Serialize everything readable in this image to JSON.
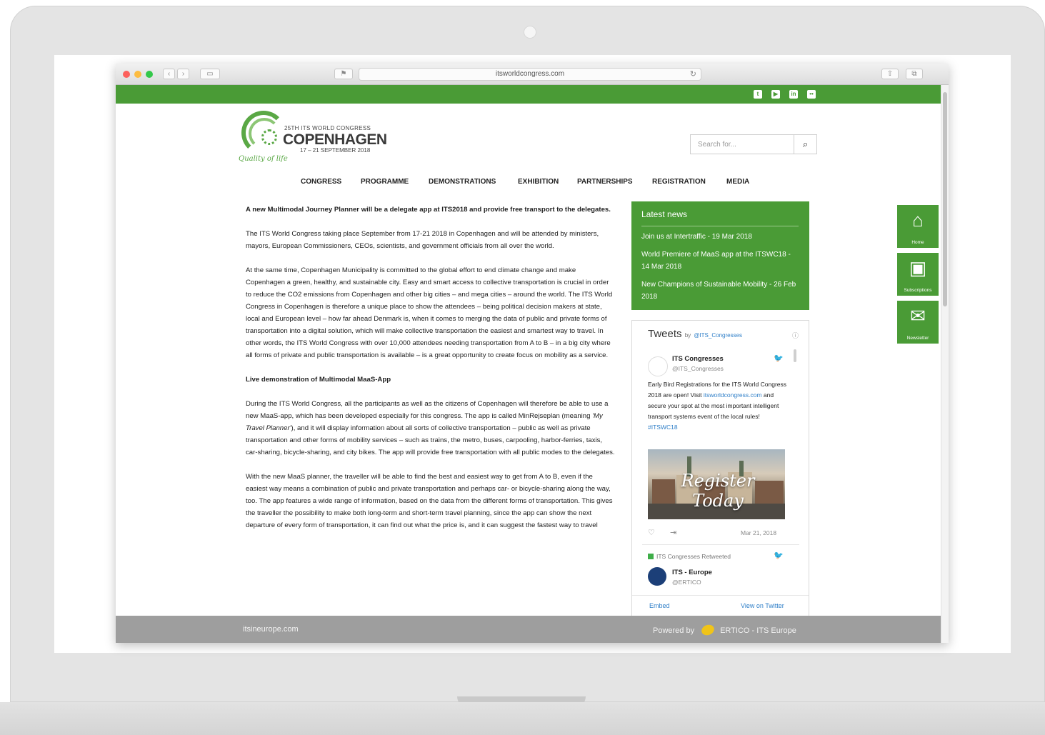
{
  "browser": {
    "url": "itsworldcongress.com",
    "nav_back": "‹",
    "nav_forward": "›"
  },
  "site": {
    "logo": {
      "sup": "25TH ITS WORLD CONGRESS",
      "title": "COPENHAGEN",
      "date": "17 – 21 SEPTEMBER 2018",
      "tagline": "Quality of life"
    },
    "search": {
      "placeholder": "Search for...",
      "icon": "search-icon"
    },
    "social_icons": [
      "twitter-icon",
      "youtube-icon",
      "linkedin-icon",
      "flickr-icon"
    ],
    "nav": [
      "CONGRESS",
      "PROGRAMME",
      "DEMONSTRATIONS",
      "EXHIBITION",
      "PARTNERSHIPS",
      "REGISTRATION",
      "MEDIA"
    ]
  },
  "article": {
    "lead": "A new Multimodal Journey Planner will be a delegate app at ITS2018 and provide free transport to the delegates.",
    "p1": "The ITS World Congress taking place September from 17-21 2018 in Copenhagen and will be attended by ministers, mayors, European Commissioners, CEOs, scientists, and government officials from all over the world.",
    "p2": "At the same time, Copenhagen Municipality is committed to the global effort to end climate change and make Copenhagen a green, healthy, and sustainable city. Easy and smart access to collective transportation is crucial in order to reduce the CO2 emissions from Copenhagen and other big cities – and mega cities – around the world. The ITS World Congress in Copenhagen is therefore a unique place to show the attendees – being political decision makers at state, local and European level – how far ahead Denmark is, when it comes to merging the data of public and private forms of transportation into a digital solution, which will make collective transportation the easiest and smartest way to travel. In other words, the ITS World Congress with over 10,000 attendees needing transportation from A to B – in a big city where all forms of private and public transportation is available – is a great opportunity to create focus on mobility as a service.",
    "subheading": "Live demonstration of Multimodal MaaS-App",
    "p3_a": "During the ITS World Congress, all the participants as well as the citizens of Copenhagen will therefore be able to use a new MaaS-app, which has been developed especially for this congress. The app is called MinRejseplan (meaning ",
    "p3_em": "'My Travel Planner'",
    "p3_b": "), and it will display information about all sorts of collective transportation – public as well as private transportation and other forms of mobility services – such as trains, the metro, buses, carpooling, harbor-ferries, taxis, car-sharing, bicycle-sharing, and city bikes. The app will provide free transportation with all public modes to the delegates.",
    "p4": "With the new MaaS planner, the traveller will be able to find the best and easiest way to get from A to B, even if the easiest way means a combination of public and private transportation and perhaps car- or bicycle-sharing along the way, too. The app features a wide range of information, based on the data from the different forms of transportation. This gives the traveller the possibility to make both long-term and short-term travel planning, since the app can show the next departure of every form of transportation, it can find out what the price is, and it can suggest the fastest way to travel"
  },
  "news": {
    "title": "Latest news",
    "items": [
      "Join us at Intertraffic - 19 Mar 2018",
      "World Premiere of MaaS app at the ITSWC18 - 14 Mar 2018",
      "New Champions of Sustainable Mobility - 26 Feb 2018"
    ]
  },
  "tweets": {
    "title": "Tweets",
    "by": "by",
    "by_handle": "@ITS_Congresses",
    "info": "ⓘ",
    "tweet1": {
      "name": "ITS Congresses",
      "handle": "@ITS_Congresses",
      "text_a": "Early Bird Registrations for the ITS World Congress 2018 are open! Visit ",
      "link": "itsworldcongress.com",
      "text_b": " and secure your spot at the most important intelligent transport systems event of the local rules! ",
      "hashtag": "#ITSWC18",
      "image_text": "Register Today",
      "date": "Mar 21, 2018"
    },
    "retweeted": "ITS Congresses Retweeted",
    "tweet2": {
      "name": "ITS - Europe",
      "handle": "@ERTICO"
    },
    "embed": "Embed",
    "view": "View on Twitter"
  },
  "footer": {
    "left": "itsineurope.com",
    "powered": "Powered by",
    "org": "ERTICO - ITS Europe"
  },
  "side_widgets": [
    {
      "label": "Home",
      "icon": "home-icon"
    },
    {
      "label": "Subscriptions",
      "icon": "calendar-plus-icon"
    },
    {
      "label": "Newsletter",
      "icon": "mail-icon"
    }
  ],
  "colors": {
    "brand_green": "#4a9b36",
    "footer_gray": "#9e9e9e",
    "link_blue": "#2f7fc8"
  }
}
